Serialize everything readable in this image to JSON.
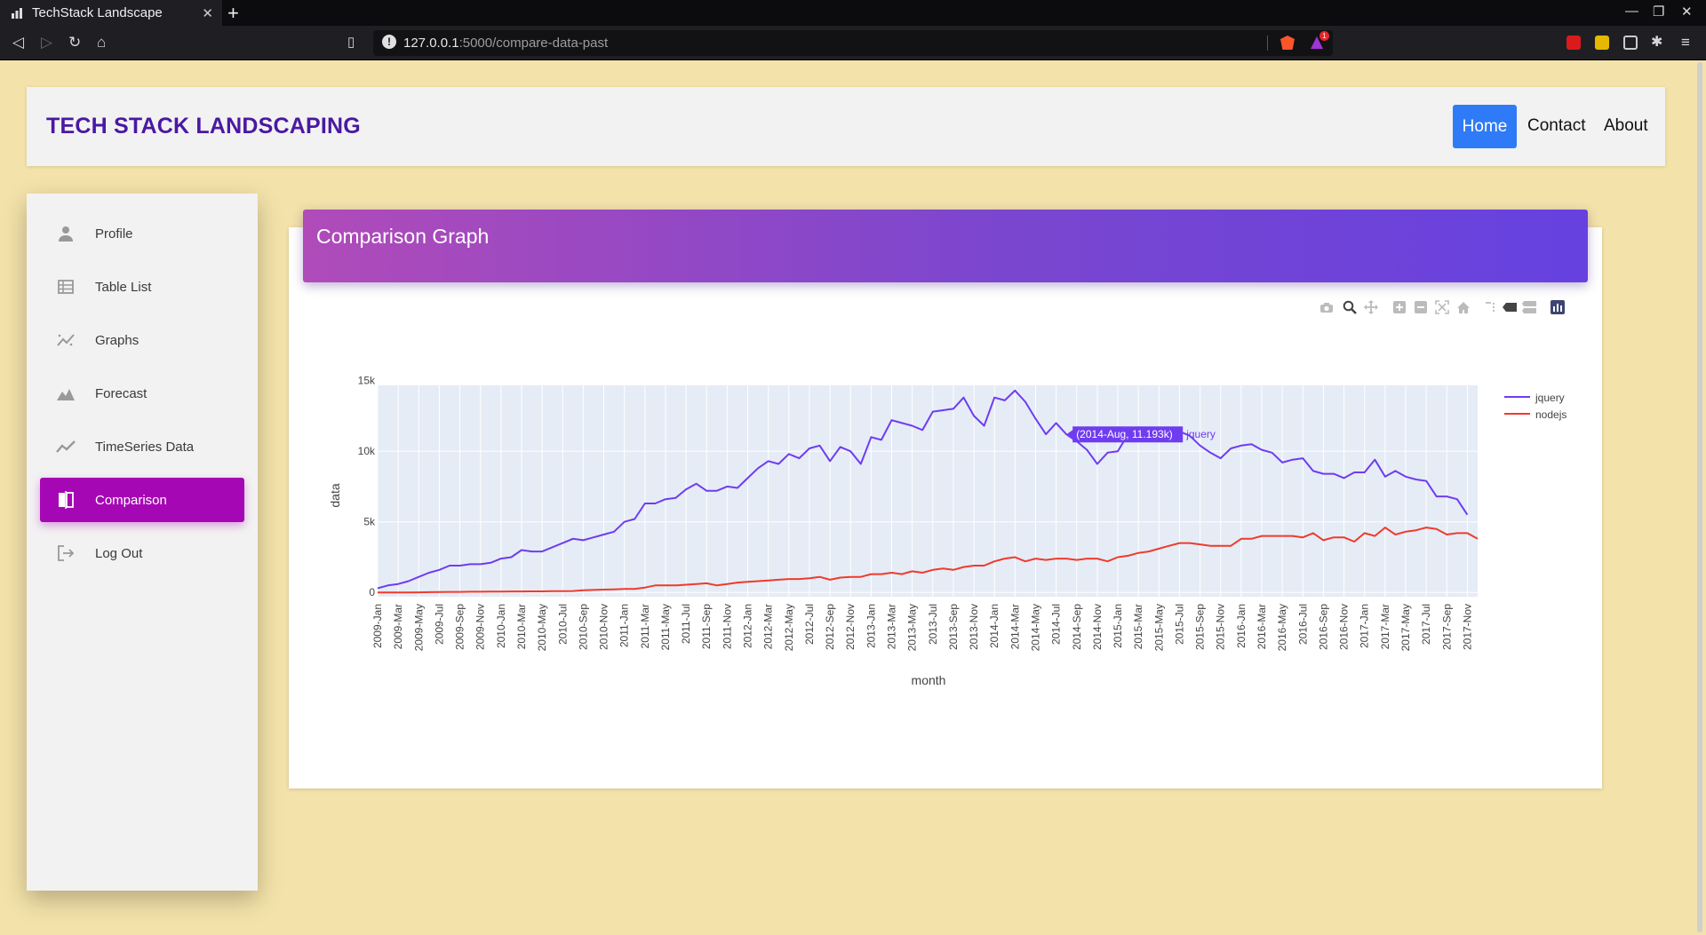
{
  "browser": {
    "tab_title": "TechStack Landscape",
    "new_tab": "+",
    "url_host": "127.0.0.1",
    "url_path": ":5000/compare-data-past",
    "badge_count": "1"
  },
  "header": {
    "brand": "TECH STACK LANDSCAPING",
    "nav": [
      "Home",
      "Contact",
      "About"
    ]
  },
  "sidebar": {
    "items": [
      {
        "label": "Profile",
        "icon": "person-icon"
      },
      {
        "label": "Table List",
        "icon": "table-icon"
      },
      {
        "label": "Graphs",
        "icon": "graph-icon"
      },
      {
        "label": "Forecast",
        "icon": "area-chart-icon"
      },
      {
        "label": "TimeSeries Data",
        "icon": "trend-icon"
      },
      {
        "label": "Comparison",
        "icon": "compare-icon",
        "active": true
      },
      {
        "label": "Log Out",
        "icon": "logout-icon"
      }
    ]
  },
  "card": {
    "title": "Comparison Graph"
  },
  "colors": {
    "jquery": "#6f3cf0",
    "nodejs": "#ef3b2c",
    "accent": "#a607b4",
    "home": "#2f7bf7"
  },
  "chart_data": {
    "type": "line",
    "xlabel": "month",
    "ylabel": "data",
    "ylim": [
      0,
      15000
    ],
    "y_ticks": [
      "0",
      "5k",
      "10k",
      "15k"
    ],
    "x_tick_labels": [
      "2009-Jan",
      "2009-Mar",
      "2009-May",
      "2009-Jul",
      "2009-Sep",
      "2009-Nov",
      "2010-Jan",
      "2010-Mar",
      "2010-May",
      "2010-Jul",
      "2010-Sep",
      "2010-Nov",
      "2011-Jan",
      "2011-Mar",
      "2011-May",
      "2011-Jul",
      "2011-Sep",
      "2011-Nov",
      "2012-Jan",
      "2012-Mar",
      "2012-May",
      "2012-Jul",
      "2012-Sep",
      "2012-Nov",
      "2013-Jan",
      "2013-Mar",
      "2013-May",
      "2013-Jul",
      "2013-Sep",
      "2013-Nov",
      "2014-Jan",
      "2014-Mar",
      "2014-May",
      "2014-Jul",
      "2014-Sep",
      "2014-Nov",
      "2015-Jan",
      "2015-Mar",
      "2015-May",
      "2015-Jul",
      "2015-Sep",
      "2015-Nov",
      "2016-Jan",
      "2016-Mar",
      "2016-May",
      "2016-Jul",
      "2016-Sep",
      "2016-Nov",
      "2017-Jan",
      "2017-Mar",
      "2017-May",
      "2017-Jul",
      "2017-Sep",
      "2017-Nov"
    ],
    "x": [
      "2009-Jan",
      "2009-Feb",
      "2009-Mar",
      "2009-Apr",
      "2009-May",
      "2009-Jun",
      "2009-Jul",
      "2009-Aug",
      "2009-Sep",
      "2009-Oct",
      "2009-Nov",
      "2009-Dec",
      "2010-Jan",
      "2010-Feb",
      "2010-Mar",
      "2010-Apr",
      "2010-May",
      "2010-Jun",
      "2010-Jul",
      "2010-Aug",
      "2010-Sep",
      "2010-Oct",
      "2010-Nov",
      "2010-Dec",
      "2011-Jan",
      "2011-Feb",
      "2011-Mar",
      "2011-Apr",
      "2011-May",
      "2011-Jun",
      "2011-Jul",
      "2011-Aug",
      "2011-Sep",
      "2011-Oct",
      "2011-Nov",
      "2011-Dec",
      "2012-Jan",
      "2012-Feb",
      "2012-Mar",
      "2012-Apr",
      "2012-May",
      "2012-Jun",
      "2012-Jul",
      "2012-Aug",
      "2012-Sep",
      "2012-Oct",
      "2012-Nov",
      "2012-Dec",
      "2013-Jan",
      "2013-Feb",
      "2013-Mar",
      "2013-Apr",
      "2013-May",
      "2013-Jun",
      "2013-Jul",
      "2013-Aug",
      "2013-Sep",
      "2013-Oct",
      "2013-Nov",
      "2013-Dec",
      "2014-Jan",
      "2014-Feb",
      "2014-Mar",
      "2014-Apr",
      "2014-May",
      "2014-Jun",
      "2014-Jul",
      "2014-Aug",
      "2014-Sep",
      "2014-Oct",
      "2014-Nov",
      "2014-Dec",
      "2015-Jan",
      "2015-Feb",
      "2015-Mar",
      "2015-Apr",
      "2015-May",
      "2015-Jun",
      "2015-Jul",
      "2015-Aug",
      "2015-Sep",
      "2015-Oct",
      "2015-Nov",
      "2015-Dec",
      "2016-Jan",
      "2016-Feb",
      "2016-Mar",
      "2016-Apr",
      "2016-May",
      "2016-Jun",
      "2016-Jul",
      "2016-Aug",
      "2016-Sep",
      "2016-Oct",
      "2016-Nov",
      "2016-Dec",
      "2017-Jan",
      "2017-Feb",
      "2017-Mar",
      "2017-Apr",
      "2017-May",
      "2017-Jun",
      "2017-Jul",
      "2017-Aug",
      "2017-Sep",
      "2017-Oct",
      "2017-Nov",
      "2017-Dec"
    ],
    "series": [
      {
        "name": "jquery",
        "values": [
          300,
          500,
          600,
          800,
          1100,
          1400,
          1600,
          1900,
          1900,
          2000,
          2000,
          2100,
          2400,
          2500,
          3000,
          2900,
          2900,
          3200,
          3500,
          3800,
          3700,
          3900,
          4100,
          4300,
          5000,
          5200,
          6300,
          6300,
          6600,
          6700,
          7300,
          7700,
          7200,
          7200,
          7500,
          7400,
          8100,
          8800,
          9300,
          9100,
          9800,
          9500,
          10200,
          10400,
          9300,
          10300,
          10000,
          9100,
          11000,
          10800,
          12200,
          12000,
          11800,
          11500,
          12800,
          12900,
          13000,
          13800,
          12500,
          11800,
          13800,
          13600,
          14300,
          13500,
          12300,
          11200,
          12000,
          11193,
          10700,
          10100,
          9100,
          9900,
          10000,
          11200,
          11700,
          11000,
          10800,
          11200,
          11400,
          11100,
          10400,
          9900,
          9500,
          10200,
          10400,
          10500,
          10100,
          9900,
          9200,
          9400,
          9500,
          8600,
          8400,
          8400,
          8100,
          8500,
          8500,
          9400,
          8200,
          8600,
          8200,
          8000,
          7900,
          6800,
          6800,
          6600,
          5500
        ]
      },
      {
        "name": "nodejs",
        "values": [
          0,
          0,
          0,
          0,
          10,
          20,
          30,
          40,
          40,
          50,
          50,
          60,
          60,
          70,
          70,
          80,
          80,
          90,
          90,
          100,
          150,
          180,
          200,
          220,
          250,
          250,
          350,
          500,
          500,
          500,
          550,
          600,
          650,
          500,
          600,
          700,
          750,
          800,
          850,
          900,
          950,
          950,
          1000,
          1100,
          900,
          1050,
          1100,
          1100,
          1300,
          1300,
          1400,
          1300,
          1500,
          1400,
          1600,
          1700,
          1600,
          1800,
          1900,
          1900,
          2200,
          2400,
          2500,
          2200,
          2400,
          2300,
          2400,
          2400,
          2300,
          2400,
          2400,
          2200,
          2500,
          2600,
          2800,
          2900,
          3100,
          3300,
          3500,
          3500,
          3400,
          3300,
          3300,
          3300,
          3800,
          3800,
          4000,
          4000,
          4000,
          4000,
          3900,
          4200,
          3700,
          3900,
          3900,
          3600,
          4200,
          4000,
          4600,
          4100,
          4300,
          4400,
          4600,
          4500,
          4100,
          4200,
          4200,
          3800
        ]
      }
    ],
    "tooltip": {
      "text": "(2014-Aug, 11.193k)",
      "series": "jquery",
      "x": "2014-Aug",
      "y": 11193
    },
    "legend": "top-right",
    "grid": true
  }
}
